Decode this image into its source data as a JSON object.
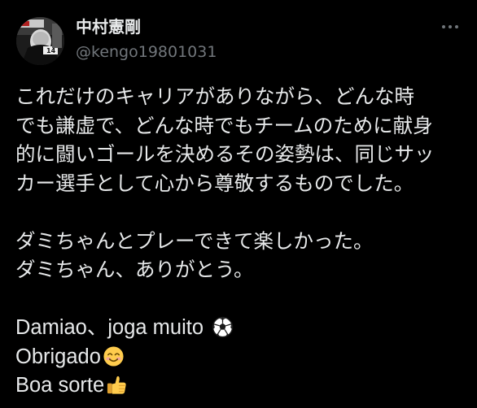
{
  "tweet": {
    "author": {
      "display_name": "中村憲剛",
      "handle": "@kengo19801031",
      "avatar_icon": "avatar-photo"
    },
    "more_icon": "more-dots-icon",
    "paragraph1": [
      "これだけのキャリアがありながら、どんな時",
      "でも謙虚で、どんな時でもチームのために献身",
      "的に闘いゴールを決めるその姿勢は、同じサッ",
      "カー選手として心から尊敬するものでした。"
    ],
    "paragraph2": [
      "ダミちゃんとプレーできて楽しかった。",
      "ダミちゃん、ありがとう。"
    ],
    "paragraph3": [
      {
        "text": "Damiao、joga muito",
        "emoji": "soccer-ball-icon"
      },
      {
        "text": "Obrigado",
        "emoji": "smiling-face-icon"
      },
      {
        "text": "Boa sorte",
        "emoji": "thumbs-up-icon"
      }
    ],
    "colors": {
      "background": "#000000",
      "text": "#e7e9ea",
      "secondary": "#71767b"
    }
  }
}
